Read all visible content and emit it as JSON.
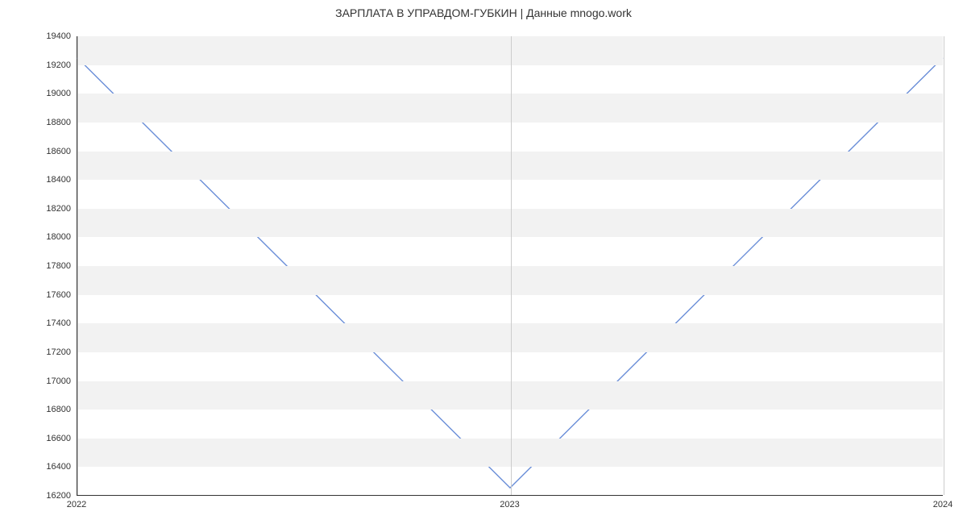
{
  "chart_data": {
    "type": "line",
    "title": "ЗАРПЛАТА В  УПРАВДОМ-ГУБКИН | Данные mnogo.work",
    "xlabel": "",
    "ylabel": "",
    "x_categories": [
      "2022",
      "2023",
      "2024"
    ],
    "values": [
      19250,
      16250,
      19250
    ],
    "ylim": [
      16200,
      19400
    ],
    "y_ticks": [
      16200,
      16400,
      16600,
      16800,
      17000,
      17200,
      17400,
      17600,
      17800,
      18000,
      18200,
      18400,
      18600,
      18800,
      19000,
      19200,
      19400
    ],
    "line_color": "#6a8ed8",
    "stripe_color": "#f2f2f2"
  }
}
